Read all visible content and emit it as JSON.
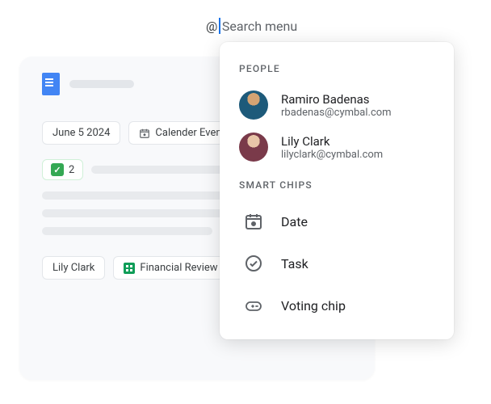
{
  "search": {
    "at_prefix": "@",
    "placeholder": "Search menu"
  },
  "doc": {
    "chips_row1": {
      "date": "June 5 2024",
      "calendar": "Calender Event"
    },
    "vote_count": "2",
    "chips_row2": {
      "person": "Lily Clark",
      "sheet": "Financial Review"
    }
  },
  "menu": {
    "heading_people": "PEOPLE",
    "people": [
      {
        "name": "Ramiro Badenas",
        "email": "rbadenas@cymbal.com"
      },
      {
        "name": "Lily Clark",
        "email": "lilyclark@cymbal.com"
      }
    ],
    "heading_chips": "SMART CHIPS",
    "chips": {
      "date": "Date",
      "task": "Task",
      "voting": "Voting chip"
    }
  }
}
